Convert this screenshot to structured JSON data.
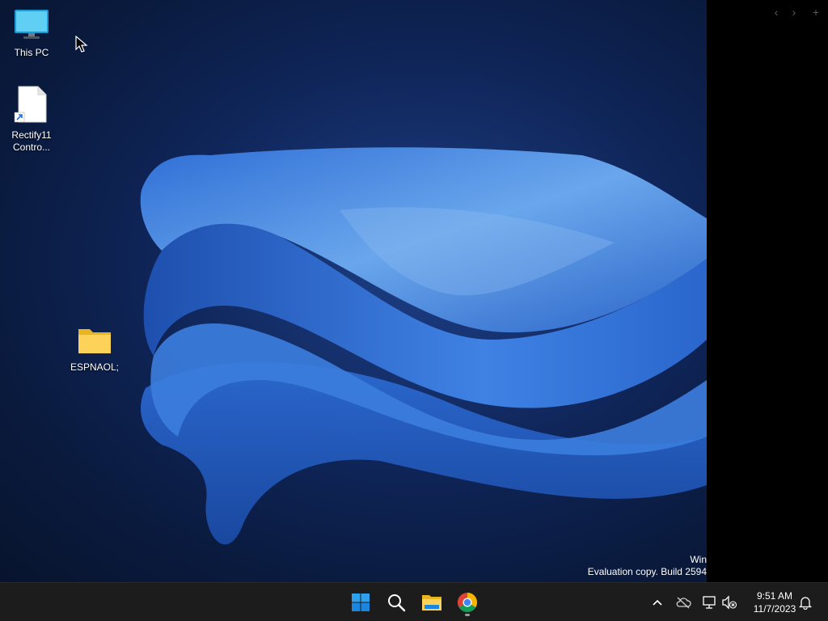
{
  "desktop": {
    "icons": [
      {
        "label": "This PC",
        "icon": "monitor-icon"
      },
      {
        "label": "Rectify11\nContro...",
        "icon": "shortcut-file-icon"
      },
      {
        "label": "ESPNAOL;",
        "icon": "folder-icon"
      }
    ],
    "watermark": {
      "line1": "Win",
      "line2": "Evaluation copy. Build 2594"
    }
  },
  "side_panel": {
    "back_glyph": "‹",
    "forward_glyph": "›",
    "add_glyph": "+"
  },
  "taskbar": {
    "pinned": [
      {
        "name": "start",
        "icon": "windows-logo-icon"
      },
      {
        "name": "search",
        "icon": "search-icon"
      },
      {
        "name": "file-explorer",
        "icon": "folder-icon"
      },
      {
        "name": "chrome",
        "icon": "chrome-icon",
        "running": true
      }
    ],
    "tray": {
      "chevron": "^",
      "icons": [
        "cloud-offline-icon",
        "network-icon",
        "volume-muted-icon"
      ]
    },
    "clock": {
      "time": "9:51 AM",
      "date": "11/7/2023"
    },
    "notification_icon": "bell-icon"
  },
  "colors": {
    "accent": "#0078d4",
    "taskbar_bg": "#1c1c1c",
    "wallpaper_dark": "#0a1a3d",
    "ribbon_blue": "#3d7fe0"
  }
}
